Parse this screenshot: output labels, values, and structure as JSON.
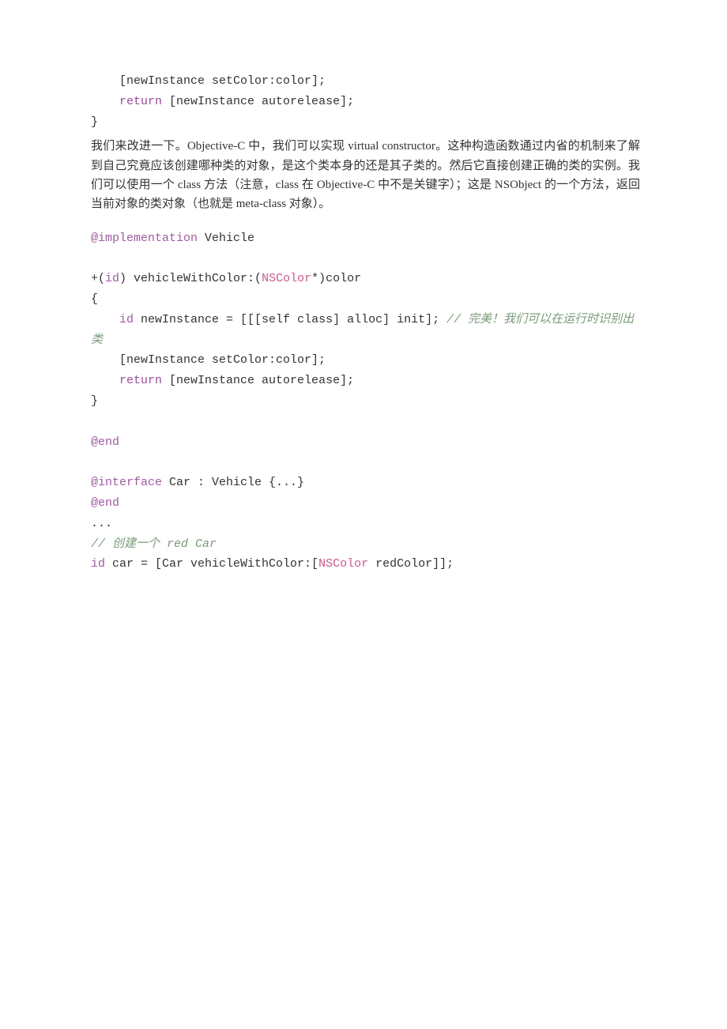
{
  "code1": {
    "line1_a": "    [newInstance setColor:color];",
    "line2_a": "    ",
    "line2_ret": "return",
    "line2_b": " [newInstance autorelease];",
    "line3": "}"
  },
  "prose": {
    "text": "我们来改进一下。Objective-C 中，我们可以实现 virtual constructor。这种构造函数通过内省的机制来了解到自己究竟应该创建哪种类的对象，是这个类本身的还是其子类的。然后它直接创建正确的类的实例。我们可以使用一个 class 方法（注意，class 在 Objective-C 中不是关键字）；这是 NSObject 的一个方法，返回当前对象的类对象（也就是 meta-class 对象）。"
  },
  "code2": {
    "impl_at": "@implementation",
    "impl_b": " Vehicle",
    "sig_a": "+(",
    "sig_id": "id",
    "sig_b": ") vehicleWithColor:(",
    "sig_ns": "NSColor",
    "sig_c": "*)color",
    "open": "{",
    "l_a": "    ",
    "l_id": "id",
    "l_b": " newInstance = [[[self class] alloc] init]; ",
    "l_comment": "// 完美！我们可以在运行时识别出类",
    "l2": "    [newInstance setColor:color];",
    "l3_a": "    ",
    "l3_ret": "return",
    "l3_b": " [newInstance autorelease];",
    "close": "}",
    "end_at": "@end"
  },
  "code3": {
    "iface_at": "@interface",
    "iface_b": " Car : Vehicle {...}",
    "end_at": "@end",
    "dots": "...",
    "comment": "// 创建一个 red Car",
    "last_id": "id",
    "last_a": " car = [Car vehicleWithColor:[",
    "last_ns": "NSColor",
    "last_b": " redColor]];"
  }
}
